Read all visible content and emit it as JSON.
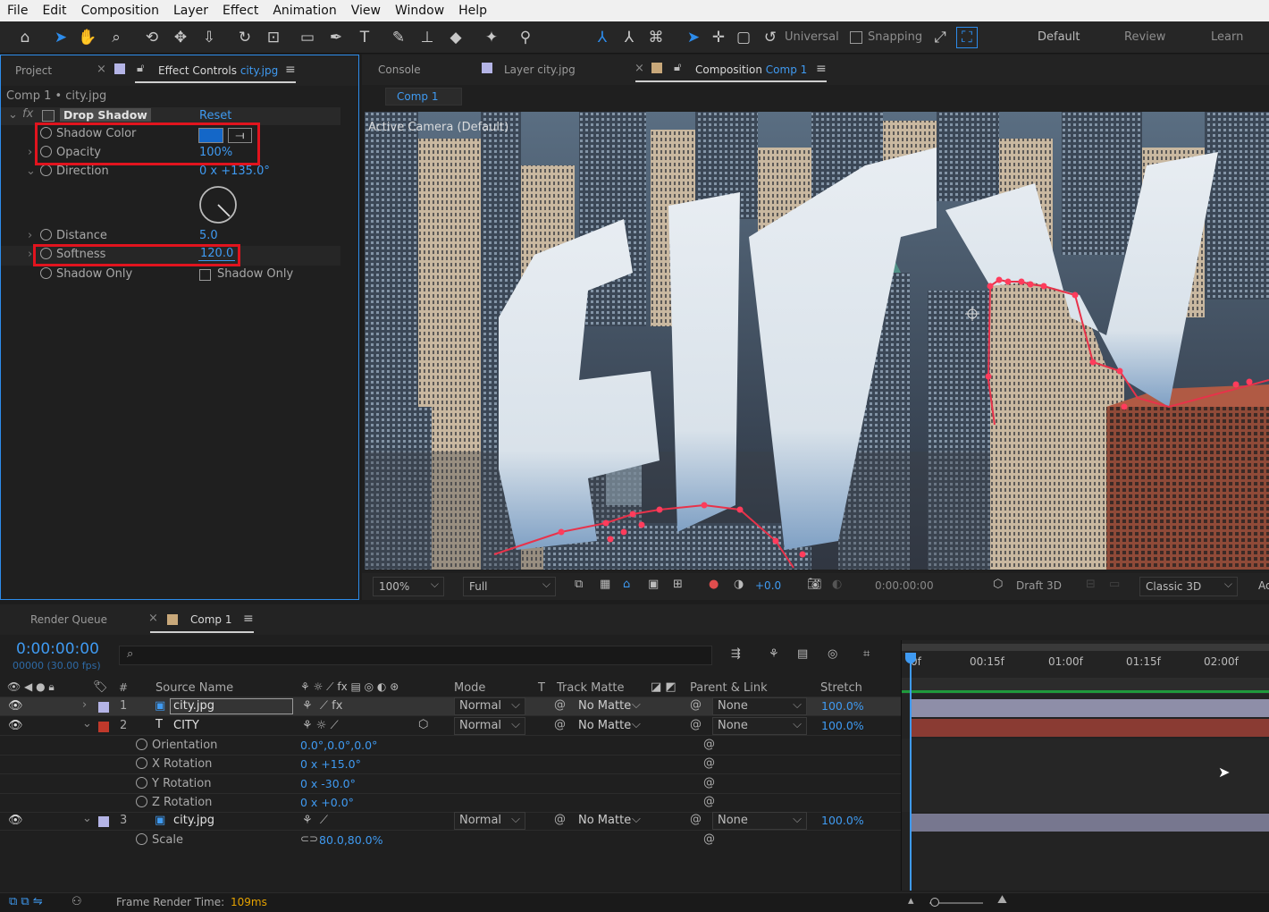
{
  "menu": [
    "File",
    "Edit",
    "Composition",
    "Layer",
    "Effect",
    "Animation",
    "View",
    "Window",
    "Help"
  ],
  "toolbar": {
    "tools": [
      "home-icon",
      "selection-tool-icon",
      "hand-tool-icon",
      "zoom-tool-icon",
      "orbit-camera-icon",
      "pan-camera-icon",
      "dolly-camera-icon",
      "rotate-tool-icon",
      "pan-behind-icon",
      "rectangle-tool-icon",
      "pen-tool-icon",
      "type-tool-icon",
      "brush-tool-icon",
      "clone-stamp-icon",
      "eraser-icon",
      "roto-brush-icon",
      "puppet-pin-icon"
    ],
    "axis_mode": "Universal",
    "snapping": "Snapping",
    "workspaces": [
      "Default",
      "Review",
      "Learn"
    ]
  },
  "left_panel": {
    "tabs": {
      "project": "Project",
      "effect_controls": "Effect Controls",
      "effect_controls_layer": "city.jpg"
    },
    "breadcrumb": "Comp 1 • city.jpg",
    "effect": {
      "fx": "fx",
      "name": "Drop Shadow",
      "reset": "Reset"
    },
    "properties": {
      "shadow_color": {
        "label": "Shadow Color",
        "color": "#1467c8"
      },
      "opacity": {
        "label": "Opacity",
        "value": "100",
        "unit": "%"
      },
      "direction": {
        "label": "Direction",
        "value": "0 x +135.0°"
      },
      "distance": {
        "label": "Distance",
        "value": "5.0"
      },
      "softness": {
        "label": "Softness",
        "value": "120.0"
      },
      "shadow_only": {
        "label": "Shadow Only",
        "checkbox_label": "Shadow Only",
        "checked": false
      }
    }
  },
  "viewer": {
    "tabs": {
      "console": "Console",
      "layer": "Layer city.jpg",
      "composition": "Composition",
      "composition_name": "Comp 1"
    },
    "subtab": "Comp 1",
    "camera_label": "Active Camera (Default)",
    "overlay_text": "CITY",
    "zoom": "100%",
    "resolution": "Full",
    "exposure": "+0.0",
    "timecode": "0:00:00:00",
    "renderer": "Draft 3D",
    "renderer_mode": "Classic 3D",
    "trail": "Ac"
  },
  "timeline": {
    "tabs": {
      "render_queue": "Render Queue",
      "comp": "Comp 1"
    },
    "timecode": "0:00:00:00",
    "frame_info": "00000 (30.00 fps)",
    "search_placeholder": "",
    "columns": {
      "num": "#",
      "source": "Source Name",
      "mode": "Mode",
      "t": "T",
      "track_matte": "Track Matte",
      "parent": "Parent & Link",
      "stretch": "Stretch"
    },
    "ruler": [
      "0f",
      "00:15f",
      "01:00f",
      "01:15f",
      "02:00f"
    ],
    "layers": [
      {
        "num": "1",
        "name": "city.jpg",
        "mode": "Normal",
        "matte": "No Matte",
        "parent": "None",
        "stretch": "100.0%",
        "color": "#b4b4e6"
      },
      {
        "num": "2",
        "name": "CITY",
        "mode": "Normal",
        "matte": "No Matte",
        "parent": "None",
        "stretch": "100.0%",
        "color": "#c0392b"
      },
      {
        "num": "3",
        "name": "city.jpg",
        "mode": "Normal",
        "matte": "No Matte",
        "parent": "None",
        "stretch": "100.0%",
        "color": "#b4b4e6"
      }
    ],
    "layer2_props": [
      {
        "label": "Orientation",
        "value": "0.0°,0.0°,0.0°"
      },
      {
        "label": "X Rotation",
        "value": "0 x +15.0°"
      },
      {
        "label": "Y Rotation",
        "value": "0 x -30.0°"
      },
      {
        "label": "Z Rotation",
        "value": "0 x +0.0°"
      }
    ],
    "layer3_props": [
      {
        "label": "Scale",
        "value": "80.0,80.0%"
      }
    ],
    "render_time_label": "Frame Render Time:",
    "render_time_value": "109ms"
  }
}
